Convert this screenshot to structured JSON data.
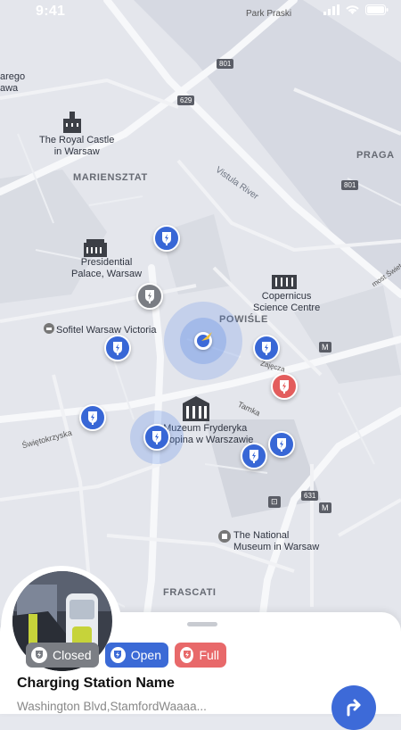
{
  "status_bar": {
    "time": "9:41",
    "location_label": "Park Praski"
  },
  "map": {
    "districts": [
      "MARIENSZTAT",
      "POWIŚLE",
      "PRAGA",
      "FRASCATI"
    ],
    "places": {
      "royal_castle": "The Royal Castle\nin Warsaw",
      "presidential_palace": "Presidential\nPalace, Warsaw",
      "copernicus": "Copernicus\nScience Centre",
      "chopin_museum": "Muzeum Fryderyka\nChopina w Warszawie",
      "national_museum": "The National\nMuseum in Warsaw",
      "sofitel": "Sofitel Warsaw Victoria",
      "ogrod": "arego\nawa"
    },
    "streets": {
      "vistula": "Vistula River",
      "swietokrzyska": "Świętokrzyska",
      "tamka": "Tamka",
      "zajecza": "Zajęcza",
      "most": "most Świet..."
    },
    "road_numbers": [
      "801",
      "629",
      "801",
      "631"
    ],
    "markers": [
      "open",
      "closed",
      "open",
      "open",
      "full",
      "open",
      "open",
      "open",
      "open"
    ]
  },
  "station": {
    "name": "Charging Station Name",
    "address": "Washington Blvd,StamfordWaaaa...",
    "status_chips": {
      "closed": "Closed",
      "open": "Open",
      "full": "Full"
    }
  },
  "colors": {
    "open": "#3867d6",
    "closed": "#7a7d83",
    "full": "#e35d5d",
    "accent": "#3d6ad8"
  }
}
